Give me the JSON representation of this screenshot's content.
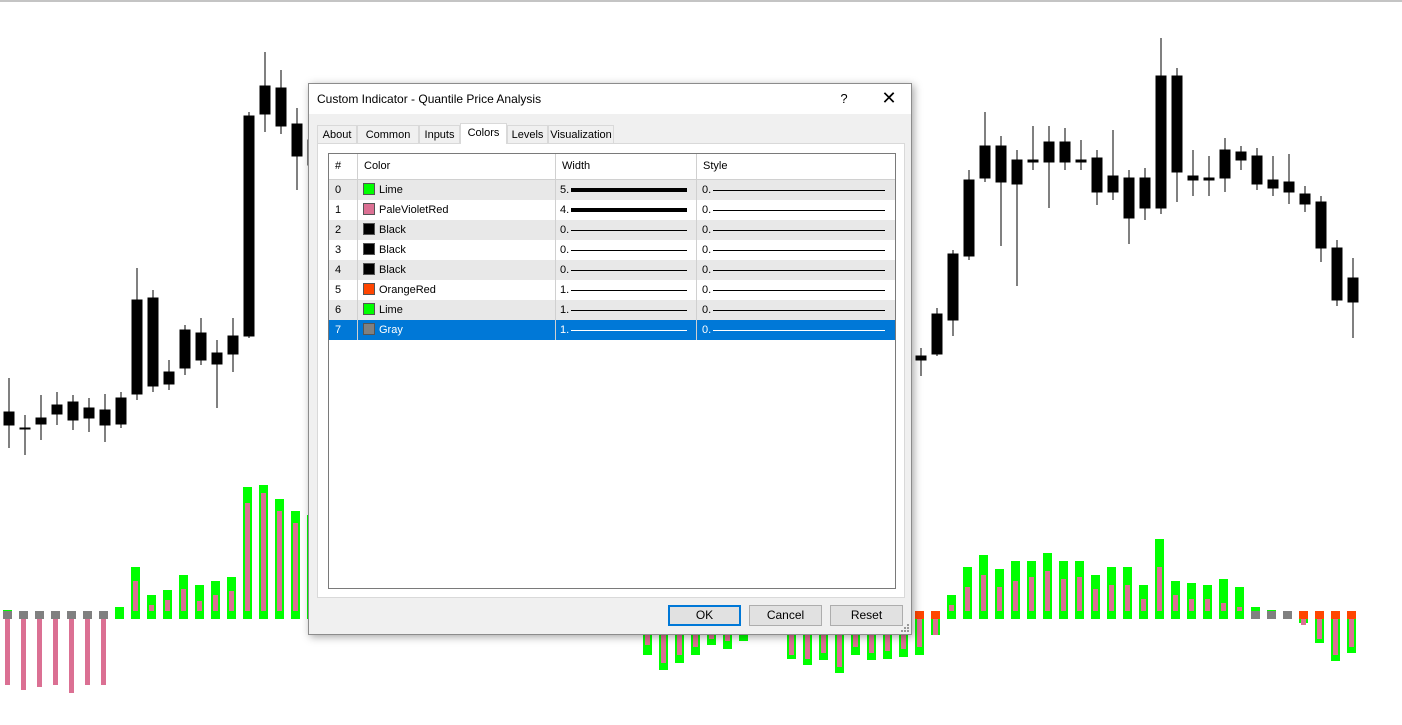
{
  "dialog": {
    "title": "Custom Indicator - Quantile Price Analysis",
    "help_label": "?",
    "close_label": "✕",
    "tabs": [
      {
        "label": "About"
      },
      {
        "label": "Common"
      },
      {
        "label": "Inputs"
      },
      {
        "label": "Colors"
      },
      {
        "label": "Levels"
      },
      {
        "label": "Visualization"
      }
    ],
    "active_tab": "Colors",
    "table": {
      "headers": {
        "index": "#",
        "color": "Color",
        "width": "Width",
        "style": "Style"
      },
      "rows": [
        {
          "index": "0",
          "color_name": "Lime",
          "swatch": "#00ff00",
          "width": "5.",
          "style": "0."
        },
        {
          "index": "1",
          "color_name": "PaleVioletRed",
          "swatch": "#db7093",
          "width": "4.",
          "style": "0."
        },
        {
          "index": "2",
          "color_name": "Black",
          "swatch": "#000000",
          "width": "0.",
          "style": "0."
        },
        {
          "index": "3",
          "color_name": "Black",
          "swatch": "#000000",
          "width": "0.",
          "style": "0."
        },
        {
          "index": "4",
          "color_name": "Black",
          "swatch": "#000000",
          "width": "0.",
          "style": "0."
        },
        {
          "index": "5",
          "color_name": "OrangeRed",
          "swatch": "#ff4500",
          "width": "1.",
          "style": "0."
        },
        {
          "index": "6",
          "color_name": "Lime",
          "swatch": "#00ff00",
          "width": "1.",
          "style": "0."
        },
        {
          "index": "7",
          "color_name": "Gray",
          "swatch": "#808080",
          "width": "1.",
          "style": "0."
        }
      ],
      "selected_row": "7"
    },
    "buttons": {
      "ok": "OK",
      "cancel": "Cancel",
      "reset": "Reset"
    }
  }
}
